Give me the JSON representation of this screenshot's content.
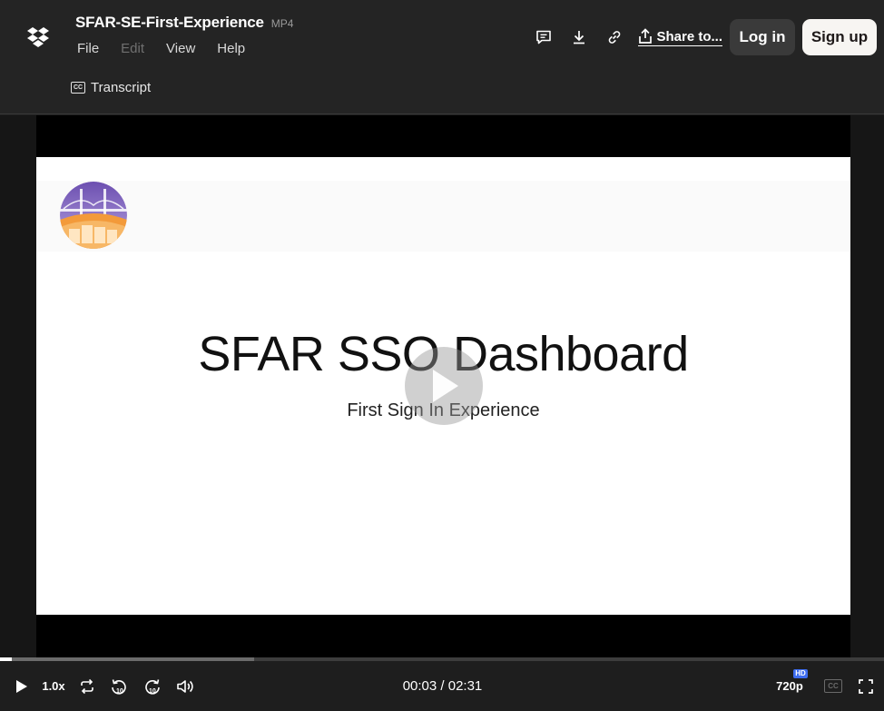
{
  "header": {
    "file_title": "SFAR-SE-First-Experience",
    "file_type": "MP4",
    "menu": [
      "File",
      "Edit",
      "View",
      "Help"
    ],
    "transcript_label": "Transcript",
    "cc_icon_text": "CC",
    "share_label": "Share to...",
    "login_label": "Log in",
    "signup_label": "Sign up"
  },
  "video": {
    "slide_title": "SFAR SSO Dashboard",
    "slide_subtitle": "First Sign In Experience"
  },
  "player": {
    "speed": "1.0x",
    "time_display": "00:03 / 02:31",
    "quality": "720p",
    "hd_badge": "HD",
    "cc_text": "CC",
    "progress": {
      "played_fraction": 0.013,
      "buffered_fraction": 0.287
    }
  },
  "colors": {
    "header_bg": "#242424",
    "signup_bg": "#f7f5f2",
    "login_bg": "#3a3a3a",
    "hd_badge": "#3d6cf0"
  }
}
